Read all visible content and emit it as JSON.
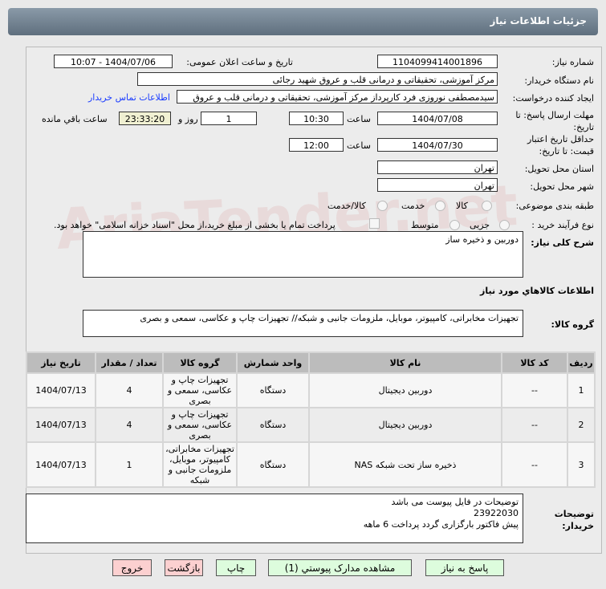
{
  "header": {
    "title": "جزئیات اطلاعات نیاز"
  },
  "watermark": "AriaTender.net",
  "form": {
    "need_number_label": "شماره نیاز:",
    "need_number": "1104099414001896",
    "announce_label": "تاریخ و ساعت اعلان عمومی:",
    "announce_value": "1404/07/06 - 10:07",
    "buyer_label": "نام دستگاه خریدار:",
    "buyer_value": "مرکز آموزشی، تحقیقاتی و درمانی قلب و عروق شهید رجائی",
    "creator_label": "ایجاد کننده درخواست:",
    "creator_value": "سیدمصطفی نوروزی فرد کارپرداز مرکز آموزشی، تحقیقاتی و درمانی قلب و عروق",
    "contact_link": "اطلاعات تماس خریدار",
    "deadline_label": "مهلت ارسال پاسخ: تا تاریخ:",
    "deadline_date": "1404/07/08",
    "time_label": "ساعت",
    "deadline_time": "10:30",
    "days": "1",
    "days_label": "روز و",
    "remaining": "23:33:20",
    "remaining_label": "ساعت باقي مانده",
    "validity_label": "حداقل تاریخ اعتبار قیمت: تا تاریخ:",
    "validity_date": "1404/07/30",
    "validity_time": "12:00",
    "province_label": "استان محل تحویل:",
    "province": "تهران",
    "city_label": "شهر محل تحویل:",
    "city": "تهران",
    "category_label": "طبقه بندی موضوعی:",
    "category_options": [
      "کالا",
      "خدمت",
      "کالا/خدمت"
    ],
    "process_label": "نوع فرآیند خرید :",
    "process_options": [
      "جزیی",
      "متوسط"
    ],
    "payment_note": "پرداخت تمام یا بخشی از مبلغ خرید،از محل \"اسناد خزانه اسلامی\" خواهد بود.",
    "summary_label": "شرح کلی نیاز:",
    "summary": "دوربین و ذخیره ساز",
    "goods_info_title": "اطلاعات کالاهاي مورد نياز",
    "goods_group_label": "گروه کالا:",
    "goods_group": "تجهیزات مخابراتی، کامپیوتر، موبایل، ملزومات جانبی و شبکه// تجهیزات چاپ و عکاسی، سمعی و بصری"
  },
  "table": {
    "headers": [
      "ردیف",
      "کد کالا",
      "نام کالا",
      "واحد شمارش",
      "گروه کالا",
      "تعداد / مقدار",
      "تاریخ نیاز"
    ],
    "rows": [
      [
        "1",
        "--",
        "دوربین دیجیتال",
        "دستگاه",
        "تجهیزات چاپ و عکاسی، سمعی و بصری",
        "4",
        "1404/07/13"
      ],
      [
        "2",
        "--",
        "دوربین دیجیتال",
        "دستگاه",
        "تجهیزات چاپ و عکاسی، سمعی و بصری",
        "4",
        "1404/07/13"
      ],
      [
        "3",
        "--",
        "ذخیره ساز تحت شبکه NAS",
        "دستگاه",
        "تجهیزات مخابراتی، کامپیوتر، موبایل، ملزومات جانبی و شبکه",
        "1",
        "1404/07/13"
      ]
    ]
  },
  "buyer_notes": {
    "label": "توضیحات خریدار:",
    "lines": [
      "توضیحات در فایل پیوست می باشد",
      "23922030",
      "پیش فاکتور بارگزاری گردد پرداخت 6 ماهه"
    ]
  },
  "buttons": {
    "reply": "پاسخ به نیاز",
    "attachments": "مشاهده مدارک پیوستي (1)",
    "print": "چاپ",
    "back": "بازگشت",
    "exit": "خروج"
  }
}
